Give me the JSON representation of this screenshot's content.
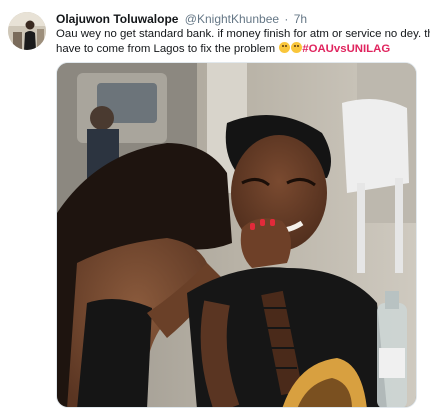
{
  "tweet": {
    "author": {
      "display_name": "Olajuwon Toluwalope",
      "handle": "@KnightKhunbee",
      "separator": "·",
      "timestamp": "7h"
    },
    "text": {
      "line1": "Oau wey no get standard bank. if money finish for atm or service no dey. they wil",
      "line2": "have to come from Lagos to fix the problem",
      "hashtag": "#OAUvsUNILAG"
    },
    "emojis": [
      "laughing-crying-emoji",
      "laughing-crying-emoji"
    ],
    "media": {
      "type": "photo"
    }
  },
  "colors": {
    "text": "#14171a",
    "secondary": "#657786",
    "hashtag": "#e0245e",
    "border": "#e1e8ed"
  }
}
